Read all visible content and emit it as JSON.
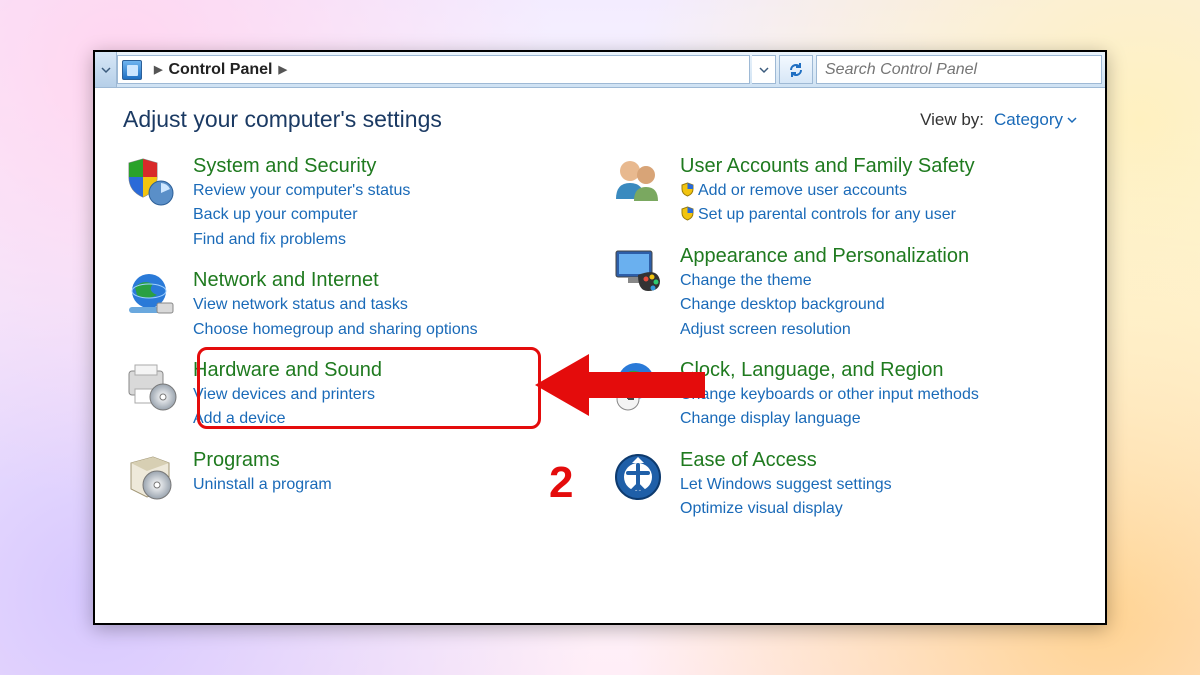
{
  "breadcrumb": {
    "location": "Control Panel"
  },
  "search": {
    "placeholder": "Search Control Panel"
  },
  "header": {
    "title": "Adjust your computer's settings",
    "viewby_label": "View by:",
    "viewby_value": "Category"
  },
  "annotation": {
    "step": "2"
  },
  "categories": {
    "left": [
      {
        "title": "System and Security",
        "links": [
          "Review your computer's status",
          "Back up your computer",
          "Find and fix problems"
        ]
      },
      {
        "title": "Network and Internet",
        "links": [
          "View network status and tasks",
          "Choose homegroup and sharing options"
        ]
      },
      {
        "title": "Hardware and Sound",
        "links": [
          "View devices and printers",
          "Add a device"
        ]
      },
      {
        "title": "Programs",
        "links": [
          "Uninstall a program"
        ]
      }
    ],
    "right": [
      {
        "title": "User Accounts and Family Safety",
        "links": [
          "Add or remove user accounts",
          "Set up parental controls for any user"
        ],
        "shield": true
      },
      {
        "title": "Appearance and Personalization",
        "links": [
          "Change the theme",
          "Change desktop background",
          "Adjust screen resolution"
        ]
      },
      {
        "title": "Clock, Language, and Region",
        "links": [
          "Change keyboards or other input methods",
          "Change display language"
        ]
      },
      {
        "title": "Ease of Access",
        "links": [
          "Let Windows suggest settings",
          "Optimize visual display"
        ]
      }
    ]
  }
}
